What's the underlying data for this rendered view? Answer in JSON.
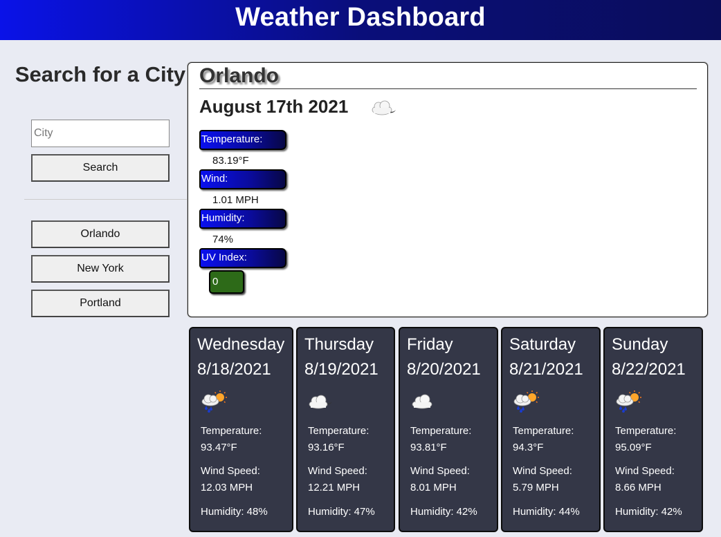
{
  "header": {
    "title": "Weather Dashboard"
  },
  "sidebar": {
    "title": "Search for a City",
    "input_placeholder": "City",
    "input_value": "",
    "search_label": "Search",
    "history": [
      "Orlando",
      "New York",
      "Portland"
    ]
  },
  "today": {
    "city": "Orlando",
    "date": "August 17th 2021",
    "icon": "partly-cloudy-night-icon",
    "temperature_label": "Temperature:",
    "temperature": "83.19°F",
    "wind_label": "Wind:",
    "wind": "1.01 MPH",
    "humidity_label": "Humidity:",
    "humidity": "74%",
    "uv_label": "UV Index:",
    "uv": "0",
    "uv_color": "#2d6a18"
  },
  "forecast": [
    {
      "day": "Wednesday",
      "date": "8/18/2021",
      "icon": "rain-sun-icon",
      "temp_label": "Temperature:",
      "temp": "93.47°F",
      "wind_label": "Wind Speed:",
      "wind": "12.03 MPH",
      "humidity": "Humidity: 48%"
    },
    {
      "day": "Thursday",
      "date": "8/19/2021",
      "icon": "partly-cloudy-night-icon",
      "temp_label": "Temperature:",
      "temp": "93.16°F",
      "wind_label": "Wind Speed:",
      "wind": "12.21 MPH",
      "humidity": "Humidity: 47%"
    },
    {
      "day": "Friday",
      "date": "8/20/2021",
      "icon": "cloud-icon",
      "temp_label": "Temperature:",
      "temp": "93.81°F",
      "wind_label": "Wind Speed:",
      "wind": "8.01 MPH",
      "humidity": "Humidity: 42%"
    },
    {
      "day": "Saturday",
      "date": "8/21/2021",
      "icon": "rain-sun-icon",
      "temp_label": "Temperature:",
      "temp": "94.3°F",
      "wind_label": "Wind Speed:",
      "wind": "5.79 MPH",
      "humidity": "Humidity: 44%"
    },
    {
      "day": "Sunday",
      "date": "8/22/2021",
      "icon": "rain-sun-icon",
      "temp_label": "Temperature:",
      "temp": "95.09°F",
      "wind_label": "Wind Speed:",
      "wind": "8.66 MPH",
      "humidity": "Humidity: 42%"
    }
  ]
}
